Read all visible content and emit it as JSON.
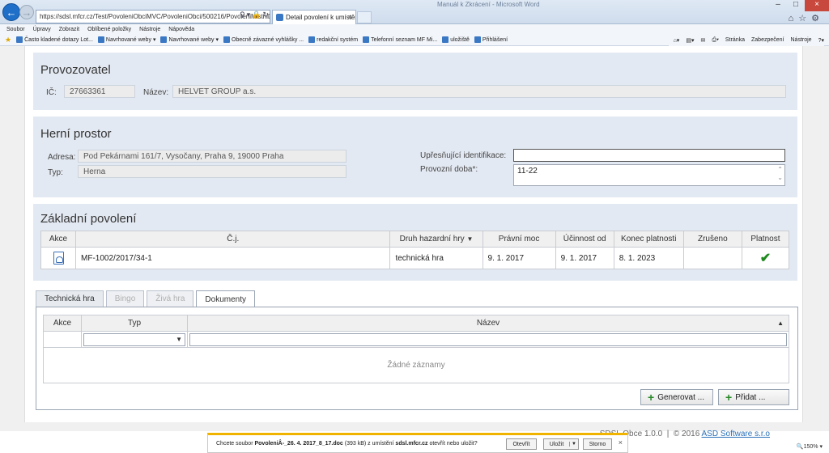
{
  "browser": {
    "url": "https://sdsl.mfcr.cz/Test/PovoleniObciMVC/PovoleniObci/500216/PovoleniMistniDr",
    "tab_title": "Detail povolení k umístění ...",
    "window_title": "Manuál k Zkrácení - Microsoft Word",
    "menu": [
      "Soubor",
      "Úpravy",
      "Zobrazit",
      "Oblíbené položky",
      "Nástroje",
      "Nápověda"
    ],
    "favorites": [
      "Často kladené dotazy Lot...",
      "Navrhované weby",
      "Navrhované weby",
      "Obecně závazné vyhlášky ...",
      "redakční systém",
      "Telefonní seznam MF Mi...",
      "uložiště",
      "Přihlášení"
    ],
    "commands": [
      "Stránka",
      "Zabezpečení",
      "Nástroje"
    ],
    "zoom": "150%"
  },
  "provozovatel": {
    "title": "Provozovatel",
    "ic_label": "IČ:",
    "ic_value": "27663361",
    "nazev_label": "Název:",
    "nazev_value": "HELVET GROUP a.s."
  },
  "herni_prostor": {
    "title": "Herní prostor",
    "adresa_label": "Adresa:",
    "adresa_value": "Pod Pekárnami 161/7, Vysočany, Praha 9, 19000 Praha",
    "typ_label": "Typ:",
    "typ_value": "Herna",
    "upresnujici_label": "Upřesňující identifikace:",
    "upresnujici_value": "",
    "provozni_doba_label": "Provozní doba*:",
    "provozni_doba_value": "11-22"
  },
  "zakladni_povoleni": {
    "title": "Základní povolení",
    "columns": [
      "Akce",
      "Č.j.",
      "Druh hazardní hry",
      "Právní moc",
      "Účinnost od",
      "Konec platnosti",
      "Zrušeno",
      "Platnost"
    ],
    "rows": [
      {
        "cj": "MF-1002/2017/34-1",
        "druh": "technická hra",
        "pravni_moc": "9. 1. 2017",
        "ucinnost_od": "9. 1. 2017",
        "konec_platnosti": "8. 1. 2023",
        "zruseno": ""
      }
    ]
  },
  "tabs": [
    {
      "label": "Technická hra"
    },
    {
      "label": "Bingo"
    },
    {
      "label": "Živá hra"
    },
    {
      "label": "Dokumenty"
    }
  ],
  "dokumenty": {
    "columns": [
      "Akce",
      "Typ",
      "Název"
    ],
    "empty_text": "Žádné záznamy",
    "generate_label": "Generovat ...",
    "add_label": "Přidat ..."
  },
  "footer": {
    "text": "SDSL Obce 1.0.0  |  © 2016 ",
    "brand": "ASD Software s.r.o"
  },
  "download": {
    "prefix": "Chcete soubor ",
    "filename": "PovoleniÂ-_26. 4. 2017_8_17.doc",
    "middle": " (393 kB) z umístění ",
    "host": "sdsl.mfcr.cz",
    "suffix": " otevřít nebo uložit?",
    "open_label": "Otevřít",
    "save_label": "Uložit",
    "cancel_label": "Storno"
  }
}
